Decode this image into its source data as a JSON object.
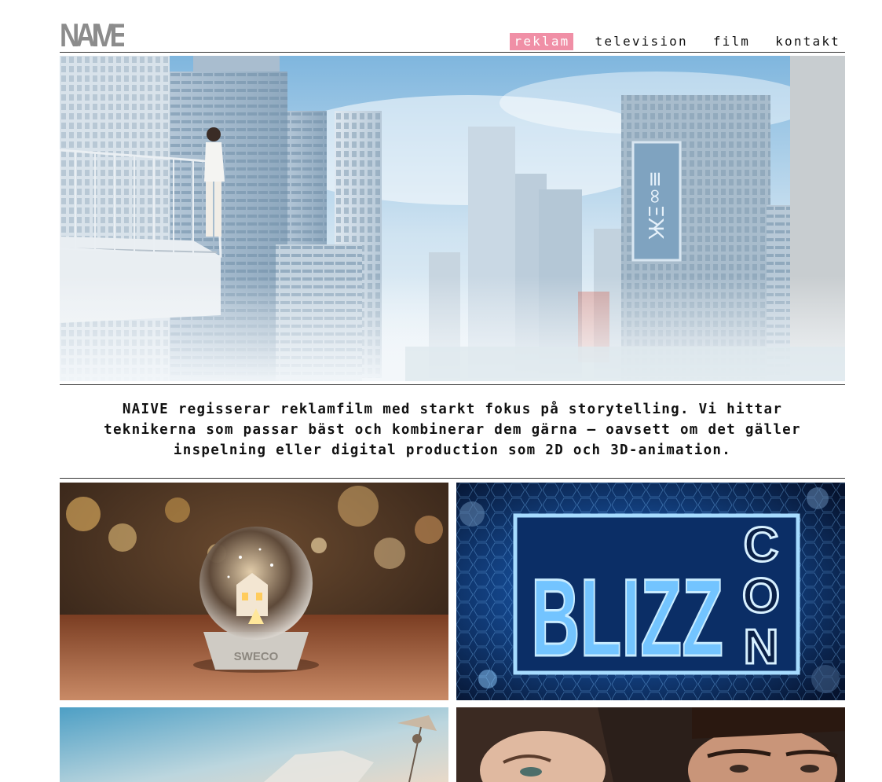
{
  "brand": {
    "logo_text": "NAIVE"
  },
  "nav": {
    "items": [
      {
        "label": "reklam",
        "active": true
      },
      {
        "label": "television",
        "active": false
      },
      {
        "label": "film",
        "active": false
      },
      {
        "label": "kontakt",
        "active": false
      }
    ]
  },
  "intro": {
    "lines": [
      "NAIVE regisserar reklamfilm med starkt fokus på storytelling. Vi hittar",
      "teknikerna som passar bäst och kombinerar dem gärna – oavsett om det gäller",
      "inspelning eller digital production som 2D och 3D-animation."
    ]
  },
  "projects": [
    {
      "name": "sweco-snow-globe",
      "sign_text": "SWECO"
    },
    {
      "name": "blizzcon",
      "sign_text": "BLIZZ",
      "side_text": "CON"
    },
    {
      "name": "sky-traveler"
    },
    {
      "name": "portrait-couple"
    }
  ],
  "colors": {
    "accent": "#f08fa6",
    "rule": "#333333"
  },
  "hero": {
    "sign_text": "≡∞ΞЖ"
  }
}
